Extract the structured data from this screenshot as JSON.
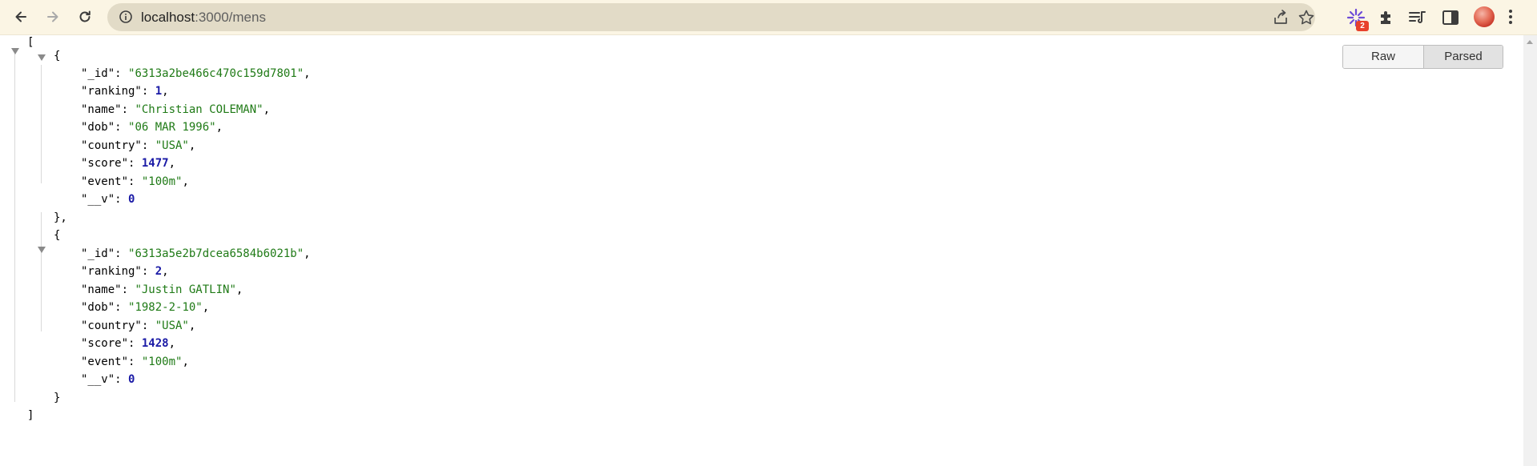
{
  "browser": {
    "url_host": "localhost",
    "url_path": ":3000/mens",
    "extension_badge": "2"
  },
  "viewer": {
    "raw_label": "Raw",
    "parsed_label": "Parsed",
    "open_bracket": "[",
    "close_bracket": "]",
    "items": [
      {
        "_id": "\"6313a2be466c470c159d7801\"",
        "ranking": "1",
        "name": "\"Christian COLEMAN\"",
        "dob": "\"06 MAR 1996\"",
        "country": "\"USA\"",
        "score": "1477",
        "event": "\"100m\"",
        "__v": "0"
      },
      {
        "_id": "\"6313a5e2b7dcea6584b6021b\"",
        "ranking": "2",
        "name": "\"Justin GATLIN\"",
        "dob": "\"1982-2-10\"",
        "country": "\"USA\"",
        "score": "1428",
        "event": "\"100m\"",
        "__v": "0"
      }
    ],
    "keys": {
      "_id": "\"_id\"",
      "ranking": "\"ranking\"",
      "name": "\"name\"",
      "dob": "\"dob\"",
      "country": "\"country\"",
      "score": "\"score\"",
      "event": "\"event\"",
      "__v": "\"__v\""
    }
  }
}
